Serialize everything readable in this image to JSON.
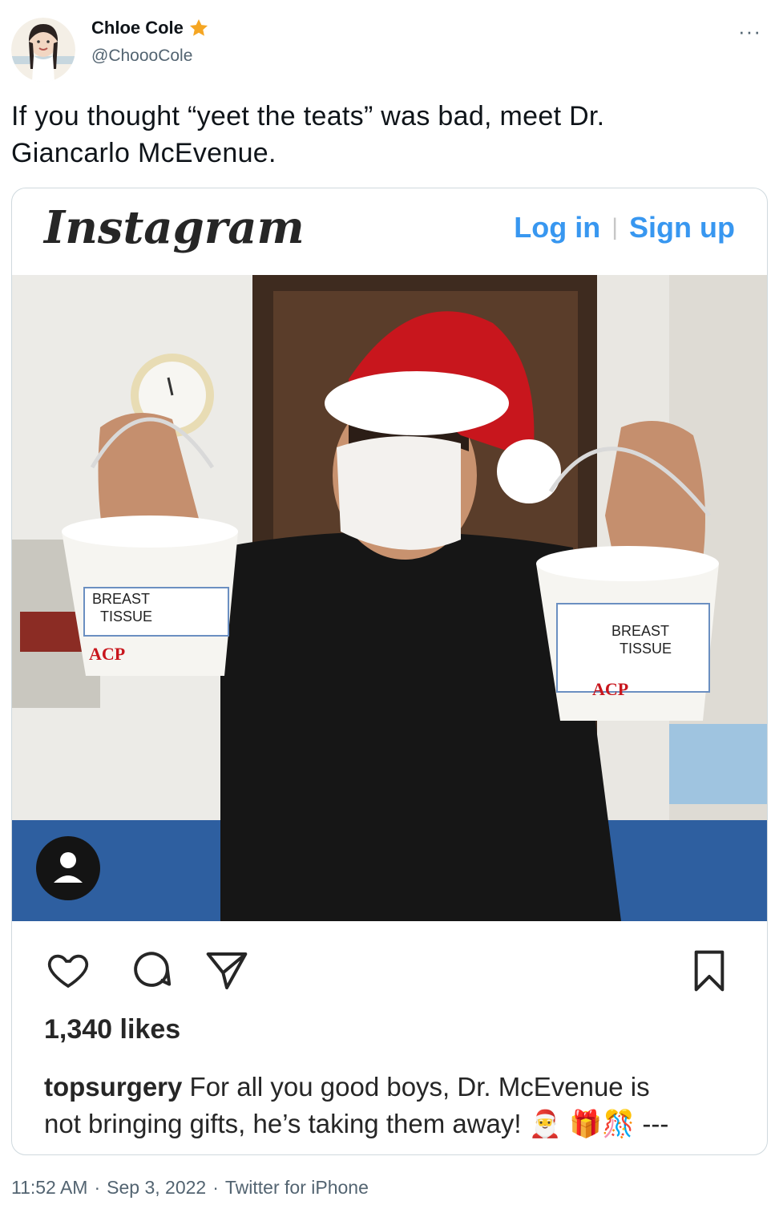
{
  "author": {
    "name": "Chloe Cole",
    "handle": "@ChoooCole",
    "badge_icon": "star-icon",
    "badge_color": "#f5a623"
  },
  "more_label": "···",
  "tweet": {
    "text_line1": "If you thought “yeet the teats” was bad, meet Dr.",
    "text_line2": "Giancarlo McEvenue."
  },
  "instagram": {
    "logo": "Instagram",
    "login": "Log in",
    "separator": "|",
    "signup": "Sign up",
    "accent_color": "#3897f0",
    "photo_labels": {
      "left_bucket_line1": "BREAST",
      "left_bucket_line2": "TISSUE",
      "left_bucket_brand": "ACP",
      "right_bucket_line1": "BREAST",
      "right_bucket_line2": "TISSUE",
      "right_bucket_brand": "ACP"
    },
    "likes": "1,340 likes",
    "caption_user": "topsurgery",
    "caption_text_line1": " For all you good boys, Dr. McEvenue is",
    "caption_text_line2": "not bringing gifts, he’s taking them away! 🎅 🎁🎊 ---"
  },
  "footer": {
    "time": "11:52 AM",
    "dot1": "·",
    "date": "Sep 3, 2022",
    "dot2": "·",
    "source": "Twitter for iPhone"
  }
}
